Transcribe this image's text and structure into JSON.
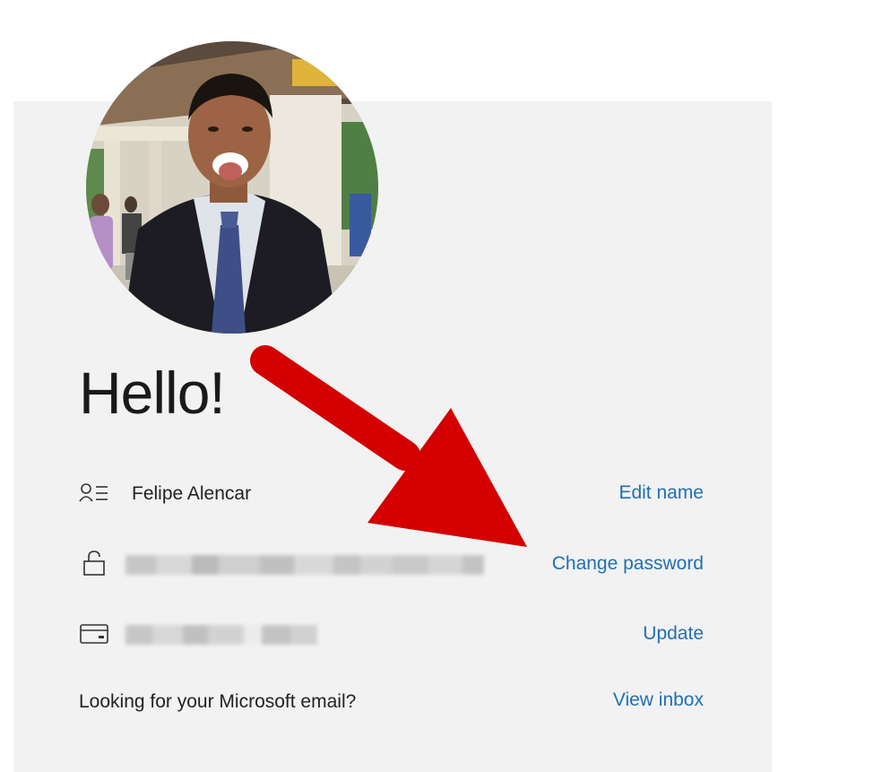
{
  "greeting": "Hello!",
  "rows": {
    "name": {
      "value": "Felipe Alencar",
      "action": "Edit name",
      "icon": "person-icon"
    },
    "password": {
      "action": "Change password",
      "icon": "lock-icon"
    },
    "payment": {
      "action": "Update",
      "icon": "credit-card-icon"
    },
    "email": {
      "label": "Looking for your Microsoft email?",
      "action": "View inbox"
    }
  },
  "colors": {
    "link": "#1f6fb5",
    "panel": "#f2f2f2",
    "arrow": "#d40000"
  }
}
